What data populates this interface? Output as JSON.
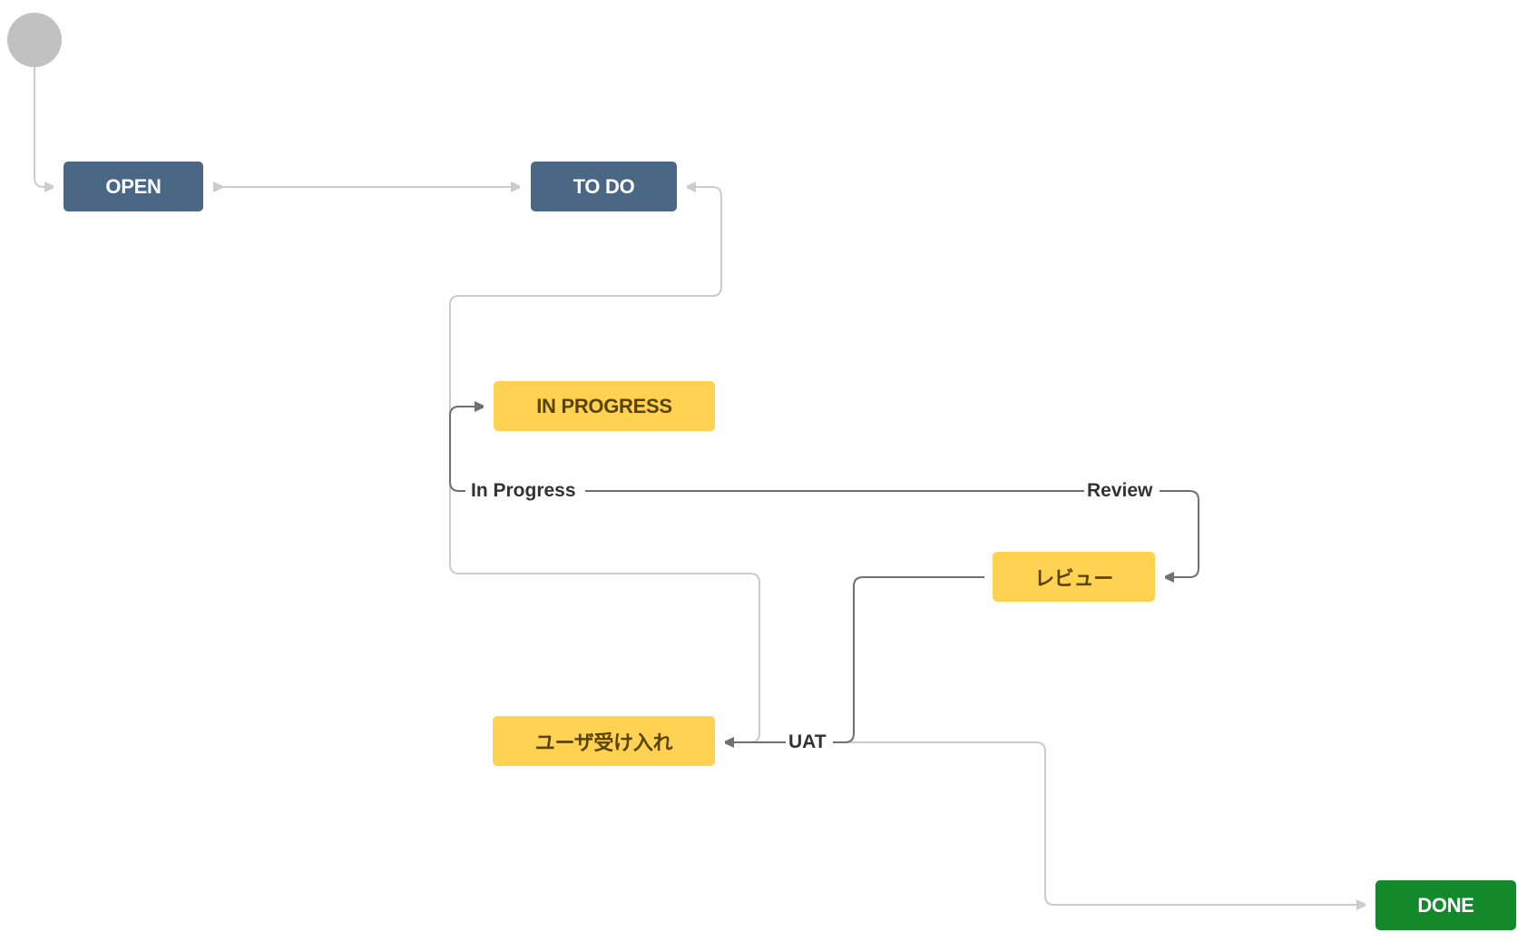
{
  "diagram": {
    "type": "workflow",
    "colors": {
      "todo_category": "#4a6785",
      "inprogress_category": "#ffd351",
      "inprogress_text": "#594300",
      "done_category": "#14892c",
      "start_node": "#c1c1c1",
      "global_transition_line": "#cccccc",
      "named_transition_line": "#707070"
    },
    "start": {
      "id": "start",
      "label": ""
    },
    "statuses": [
      {
        "id": "open",
        "label": "OPEN",
        "category": "todo"
      },
      {
        "id": "todo",
        "label": "TO DO",
        "category": "todo"
      },
      {
        "id": "inprogress",
        "label": "IN PROGRESS",
        "category": "inprogress"
      },
      {
        "id": "review",
        "label": "レビュー",
        "category": "inprogress"
      },
      {
        "id": "uat",
        "label": "ユーザ受け入れ",
        "category": "inprogress"
      },
      {
        "id": "done",
        "label": "DONE",
        "category": "done"
      }
    ],
    "transitions": [
      {
        "from": "start",
        "to": "open",
        "label": ""
      },
      {
        "from": "open",
        "to": "todo",
        "label": "",
        "bidirectional": true
      },
      {
        "from": "inprogress",
        "to": "todo",
        "label": ""
      },
      {
        "from": "review",
        "to": "inprogress",
        "label": "In Progress"
      },
      {
        "from": "inprogress",
        "to": "review",
        "label": "Review"
      },
      {
        "from": "review",
        "to": "uat",
        "label": "UAT"
      },
      {
        "from": "inprogress",
        "to": "uat",
        "label": ""
      },
      {
        "from": "uat",
        "to": "done",
        "label": ""
      }
    ],
    "edge_labels": {
      "in_progress": "In Progress",
      "review": "Review",
      "uat": "UAT"
    }
  }
}
